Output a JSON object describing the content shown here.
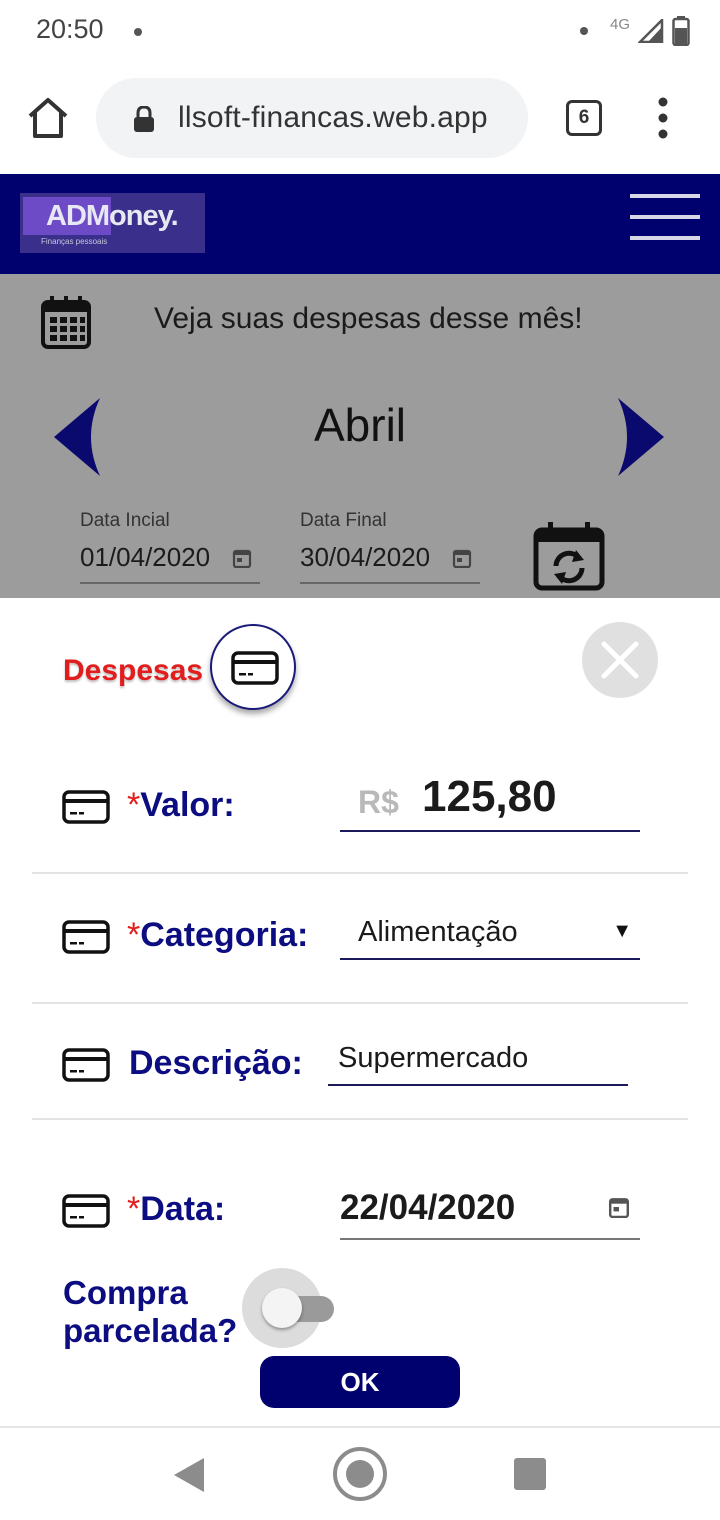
{
  "status_bar": {
    "time": "20:50",
    "network": "4G"
  },
  "browser": {
    "url": "llsoft-financas.web.app",
    "tab_count": "6"
  },
  "app": {
    "logo_text": "ADMoney.",
    "logo_subtitle": "Finanças pessoais",
    "brand_color": "#00006e"
  },
  "page": {
    "subtitle": "Veja suas despesas desse mês!",
    "month": "Abril",
    "start_date_label": "Data Incial",
    "start_date_value": "01/04/2020",
    "end_date_label": "Data Final",
    "end_date_value": "30/04/2020"
  },
  "sheet": {
    "title": "Despesas",
    "required_mark": "*",
    "fields": {
      "valor_label": "Valor:",
      "valor_prefix": "R$",
      "valor_value": "125,80",
      "categoria_label": "Categoria:",
      "categoria_value": "Alimentação",
      "descricao_label": "Descrição:",
      "descricao_value": "Supermercado",
      "data_label": "Data:",
      "data_value": "22/04/2020",
      "parcelada_label_line1": "Compra",
      "parcelada_label_line2": "parcelada?",
      "parcelada_on": false
    },
    "ok_label": "OK",
    "accent_red": "#e11d1d",
    "label_blue": "#0d0d82"
  }
}
